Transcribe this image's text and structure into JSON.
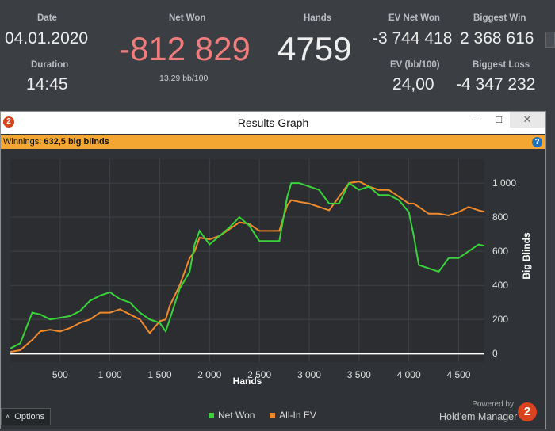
{
  "stats": {
    "date_label": "Date",
    "date_value": "04.01.2020",
    "duration_label": "Duration",
    "duration_value": "14:45",
    "net_won_label": "Net Won",
    "net_won_value": "-812 829",
    "net_won_bb": "13,29 bb/100",
    "hands_label": "Hands",
    "hands_value": "4759",
    "ev_net_won_label": "EV Net Won",
    "ev_net_won_value": "-3 744 418",
    "ev_bb_label": "EV (bb/100)",
    "ev_bb_value": "24,00",
    "biggest_win_label": "Biggest Win",
    "biggest_win_value": "2 368 616",
    "biggest_loss_label": "Biggest Loss",
    "biggest_loss_value": "-4 347 232"
  },
  "window": {
    "title": "Results Graph",
    "logo_glyph": "2",
    "minimize_glyph": "—",
    "maximize_glyph": "□",
    "close_glyph": "✕",
    "winnings_label": "Winnings:",
    "winnings_value": "632,5 big blinds",
    "help_glyph": "?"
  },
  "footer": {
    "options_label": "Options",
    "options_arrow": "˄",
    "legend_net_won": "Net Won",
    "legend_allin_ev": "All-In EV",
    "powered_by": "Powered by",
    "brand": "Hold'em Manager",
    "brand_logo": "2"
  },
  "colors": {
    "net_won_negative": "#f27c7c",
    "net_won_series": "#39d43a",
    "allin_ev_series": "#f08a2c",
    "winnings_bar": "#f4a632"
  },
  "chart_data": {
    "type": "line",
    "xlabel": "Hands",
    "ylabel": "Big Blinds",
    "xlim": [
      0,
      4759
    ],
    "ylim": [
      -50,
      1140
    ],
    "x_ticks": [
      500,
      1000,
      1500,
      2000,
      2500,
      3000,
      3500,
      4000,
      4500
    ],
    "x_tick_labels": [
      "500",
      "1 000",
      "1 500",
      "2 000",
      "2 500",
      "3 000",
      "3 500",
      "4 000",
      "4 500"
    ],
    "y_ticks": [
      0,
      200,
      400,
      600,
      800,
      1000
    ],
    "y_tick_labels": [
      "0",
      "200",
      "400",
      "600",
      "800",
      "1 000"
    ],
    "grid": true,
    "legend_position": "bottom-center",
    "series": [
      {
        "name": "Net Won",
        "color": "#39d43a",
        "x": [
          0,
          100,
          220,
          300,
          400,
          500,
          600,
          700,
          800,
          900,
          1000,
          1100,
          1200,
          1300,
          1400,
          1500,
          1560,
          1600,
          1700,
          1800,
          1850,
          1900,
          2000,
          2100,
          2200,
          2300,
          2400,
          2500,
          2600,
          2700,
          2780,
          2820,
          2900,
          3000,
          3100,
          3200,
          3300,
          3400,
          3500,
          3600,
          3700,
          3800,
          3900,
          4000,
          4050,
          4100,
          4200,
          4300,
          4400,
          4500,
          4600,
          4700,
          4759
        ],
        "y": [
          30,
          60,
          240,
          230,
          200,
          210,
          220,
          250,
          310,
          340,
          360,
          320,
          300,
          240,
          200,
          180,
          130,
          200,
          380,
          480,
          640,
          720,
          640,
          690,
          740,
          800,
          750,
          660,
          660,
          660,
          920,
          1000,
          1000,
          980,
          960,
          880,
          880,
          1000,
          960,
          980,
          930,
          930,
          900,
          830,
          690,
          520,
          500,
          480,
          560,
          560,
          600,
          640,
          632
        ]
      },
      {
        "name": "All-In EV",
        "color": "#f08a2c",
        "x": [
          0,
          100,
          220,
          300,
          400,
          500,
          600,
          700,
          800,
          900,
          1000,
          1100,
          1200,
          1300,
          1400,
          1500,
          1560,
          1600,
          1700,
          1800,
          1850,
          1900,
          2000,
          2100,
          2200,
          2300,
          2400,
          2500,
          2600,
          2700,
          2780,
          2820,
          2900,
          3000,
          3100,
          3200,
          3300,
          3400,
          3500,
          3600,
          3700,
          3800,
          3900,
          4000,
          4050,
          4100,
          4200,
          4300,
          4400,
          4500,
          4600,
          4700,
          4759
        ],
        "y": [
          10,
          20,
          80,
          130,
          140,
          130,
          150,
          180,
          200,
          240,
          240,
          260,
          230,
          200,
          120,
          190,
          200,
          280,
          400,
          560,
          600,
          680,
          670,
          690,
          730,
          770,
          760,
          720,
          720,
          720,
          870,
          900,
          890,
          880,
          860,
          840,
          920,
          1000,
          1010,
          980,
          960,
          960,
          920,
          880,
          880,
          860,
          820,
          820,
          810,
          830,
          860,
          840,
          832
        ]
      }
    ]
  }
}
